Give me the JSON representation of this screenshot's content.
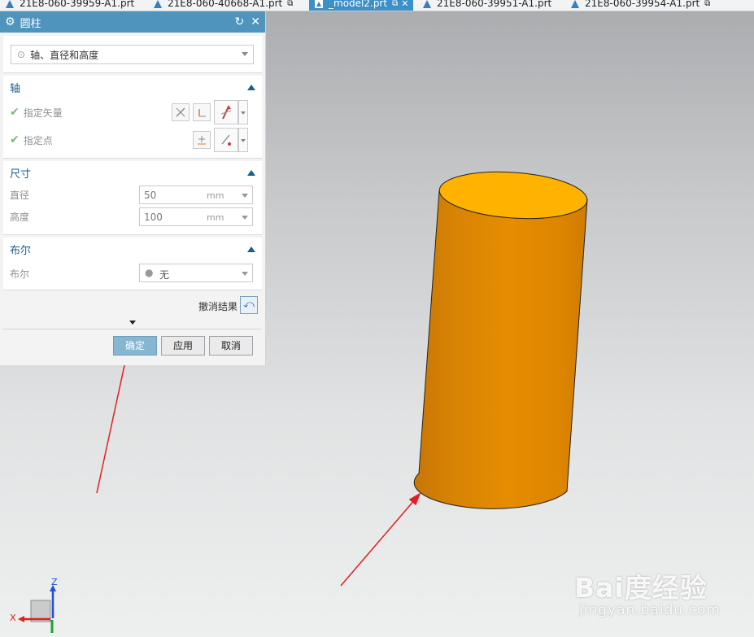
{
  "tabs": [
    {
      "label": "21E8-060-39959-A1.prt",
      "active": false
    },
    {
      "label": "21E8-060-40668-A1.prt",
      "active": false
    },
    {
      "label": "_model2.prt",
      "active": true
    },
    {
      "label": "21E8-060-39951-A1.prt",
      "active": false
    },
    {
      "label": "21E8-060-39954-A1.prt",
      "active": false
    }
  ],
  "dialog": {
    "title": "圆柱",
    "type_value": "轴、直径和高度",
    "axis": {
      "header": "轴",
      "specify_vector": "指定矢量",
      "specify_point": "指定点"
    },
    "dimensions": {
      "header": "尺寸",
      "diameter_label": "直径",
      "diameter_value": "50",
      "diameter_unit": "mm",
      "height_label": "高度",
      "height_value": "100",
      "height_unit": "mm"
    },
    "boolean": {
      "header": "布尔",
      "label": "布尔",
      "value": "无"
    },
    "undo_result": "撤消结果",
    "buttons": {
      "ok": "确定",
      "apply": "应用",
      "cancel": "取消"
    }
  },
  "triad": {
    "x_label": "X",
    "z_label": "Z"
  },
  "watermark": {
    "logo": "Bai度经验",
    "url": "jingyan.baidu.com"
  },
  "colors": {
    "accent": "#4f94bd",
    "cylinder_side": "#e08a00",
    "cylinder_top": "#ffb300",
    "annotation_arrow": "#e02020"
  }
}
